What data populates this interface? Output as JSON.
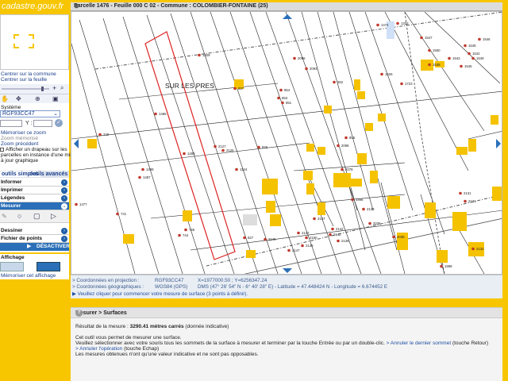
{
  "brand": {
    "logo_text": "cadastre.gouv.fr"
  },
  "left_panel": {
    "center_commune": "Centrer sur la commune",
    "center_feuille": "Centrer sur la feuille",
    "systeme_label": "Système",
    "systeme_value": "RGF93CC47",
    "y_label": "Y :",
    "memoriser_zoom": "Mémoriser ce zoom",
    "zoom_memorise": "Zoom mémorisé",
    "zoom_precedent": "Zoom précédent",
    "flag_text_1": "Afficher un drapeau sur les",
    "flag_text_2": "parcelles en instance d'une mise",
    "flag_text_3": "à jour graphique",
    "tab_simple": "outils simples",
    "tab_avances": "outils avancés",
    "informer": "Informer",
    "imprimer": "Imprimer",
    "legendes": "Légendes",
    "mesurer": "Mesurer",
    "dessiner": "Dessiner",
    "fichier_points": "Fichier de points",
    "desactiver": "DÉSACTIVER",
    "affichage": "Affichage",
    "memoriser_affichage": "Mémoriser cet affichage"
  },
  "map": {
    "title": "Parcelle 1476 - Feuille 000 C 02 - Commune : COLOMBIER-FONTAINE (25)",
    "lieu_dit": "SUR LES PRES",
    "labels": [
      "1329",
      "2096",
      "2093",
      "1323",
      "1547",
      "1546",
      "1549",
      "1538",
      "1543",
      "1542",
      "1526",
      "1723",
      "827",
      "854",
      "853",
      "851",
      "352",
      "1550",
      "1545",
      "1548",
      "1474",
      "740",
      "2098",
      "826",
      "805",
      "2127",
      "2126",
      "1124",
      "2078",
      "2131",
      "1477",
      "1466",
      "2133",
      "2035",
      "2142",
      "2137",
      "2136",
      "1998",
      "2131",
      "2132",
      "2137",
      "2036",
      "2145",
      "2147",
      "2149",
      "2150",
      "2142",
      "827",
      "741",
      "745",
      "744",
      "1486",
      "1489",
      "1487",
      "1488"
    ]
  },
  "coords": {
    "projection_label": "> Coordonnées en projection :",
    "projection_system": "RGF93CC47",
    "projection_value": "X=1977000.50 ; Y=6256347.24",
    "geo_label": "> Coordonnées géographiques :",
    "geo_system": "WGS84 (GPS)",
    "geo_value": "DMS (47° 26' 54\" N - 6° 40' 28\" E) - Latitude = 47.448424 N - Longitude = 6.674452 E",
    "hint": "▶ Veuillez cliquer pour commencer votre mesure de surface (3 points à définir)."
  },
  "bottom": {
    "header": "Mesurer > Surfaces",
    "result_label": "Résultat de la mesure :",
    "result_value": "3290.41 mètres carrés",
    "result_note": "(donnée indicative)",
    "line1": "Cet outil vous permet de mesurer une surface.",
    "line2": "Veuillez sélectionner avec votre souris tous les sommets de la surface à mesurer et terminer par la touche Entrée ou par un double-clic.",
    "link_cancel_last": "> Annuler le dernier sommet",
    "cancel_last_key": "(touche Retour)",
    "link_cancel_op": "> Annuler l'opération",
    "cancel_op_key": "(touche Echap)",
    "line3": "Les mesures obtenues n'ont qu'une valeur indicative et ne sont pas opposables."
  }
}
